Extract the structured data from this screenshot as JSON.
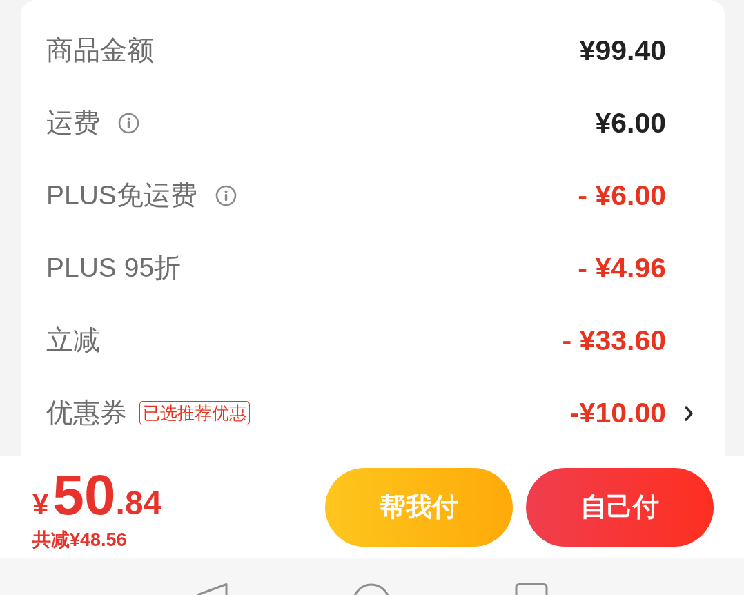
{
  "fee_rows": [
    {
      "label": "商品金额",
      "info": false,
      "kind": "charge",
      "value": "¥99.40"
    },
    {
      "label": "运费",
      "info": true,
      "kind": "charge",
      "value": "¥6.00"
    },
    {
      "label": "PLUS免运费",
      "info": true,
      "kind": "discount",
      "value": "- ¥6.00"
    },
    {
      "label": "PLUS 95折",
      "info": false,
      "kind": "discount",
      "value": "- ¥4.96"
    },
    {
      "label": "立减",
      "info": false,
      "kind": "discount",
      "value": "- ¥33.60"
    },
    {
      "label": "优惠券",
      "info": false,
      "badge": "已选推荐优惠",
      "kind": "discount",
      "value": "-¥10.00",
      "chevron": true
    }
  ],
  "checkout": {
    "total": {
      "symbol": "¥",
      "whole": "50",
      "fraction": ".84"
    },
    "savings": "共减¥48.56",
    "buttons": [
      {
        "label": "帮我付",
        "kind": "secondary"
      },
      {
        "label": "自己付",
        "kind": "primary"
      }
    ]
  }
}
